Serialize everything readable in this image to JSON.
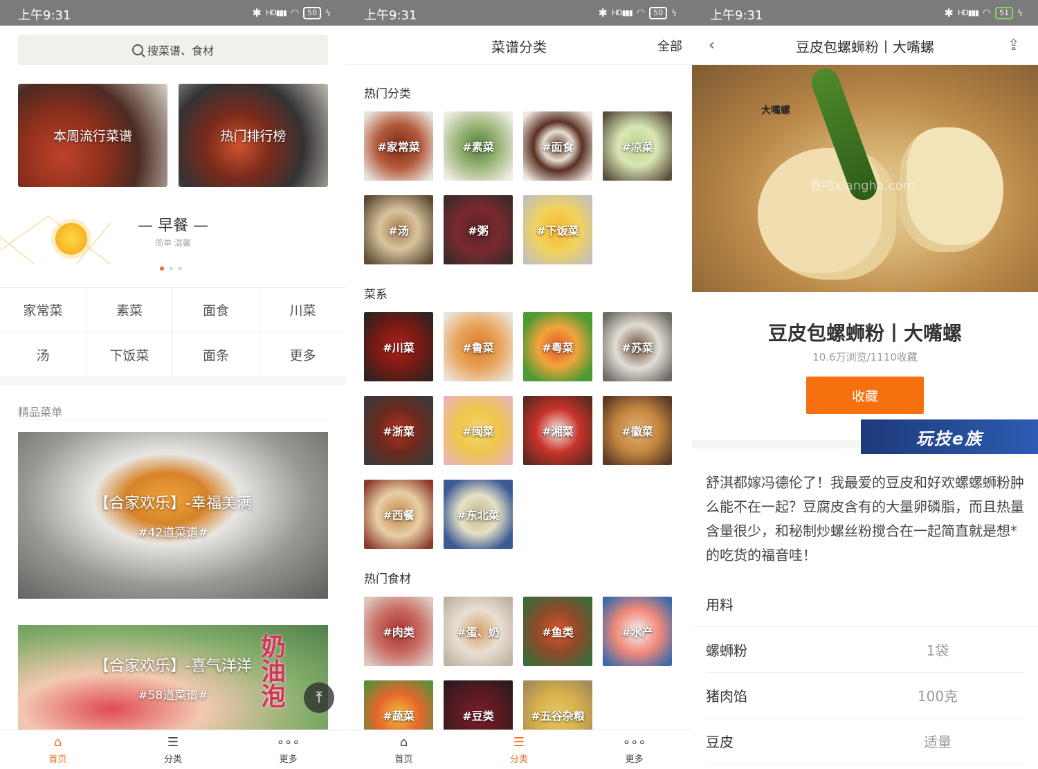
{
  "status": {
    "time": "上午9:31",
    "signal": "HD",
    "battery": [
      "50",
      "50",
      "51"
    ]
  },
  "home": {
    "search_placeholder": "搜菜谱、食材",
    "banners": [
      "本周流行菜谱",
      "热门排行榜"
    ],
    "meal": {
      "title": "— 早餐 —",
      "subtitle": "简单 温馨"
    },
    "categories": [
      "家常菜",
      "素菜",
      "面食",
      "川菜",
      "汤",
      "下饭菜",
      "面条",
      "更多"
    ],
    "section_label": "精品菜单",
    "menus": [
      {
        "title": "【合家欢乐】-幸福美满",
        "count": "#42道菜谱#"
      },
      {
        "title": "【合家欢乐】-喜气洋洋",
        "count": "#58道菜谱#"
      }
    ],
    "menu2_overlay": "奶油泡"
  },
  "tabs": [
    "首页",
    "分类",
    "更多"
  ],
  "categories_page": {
    "title": "菜谱分类",
    "right": "全部",
    "groups": [
      {
        "title": "热门分类",
        "items": [
          "#家常菜",
          "#素菜",
          "#面食",
          "#凉菜",
          "#汤",
          "#粥",
          "#下饭菜"
        ]
      },
      {
        "title": "菜系",
        "items": [
          "#川菜",
          "#鲁菜",
          "#粤菜",
          "#苏菜",
          "#浙菜",
          "#闽菜",
          "#湘菜",
          "#徽菜",
          "#西餐",
          "#东北菜"
        ]
      },
      {
        "title": "热门食材",
        "items": [
          "#肉类",
          "#蛋、奶",
          "#鱼类",
          "#水产",
          "#蔬菜",
          "#豆类",
          "#五谷杂粮"
        ]
      }
    ]
  },
  "recipe": {
    "nav_title": "豆皮包螺蛳粉丨大嘴螺",
    "title": "豆皮包螺蛳粉丨大嘴螺",
    "stats": "10.6万浏览/1110收藏",
    "favorite": "收藏",
    "image_brand": "大嘴螺",
    "watermark": "香哈xiangha.com",
    "promo": "玩技e族",
    "description": "舒淇都嫁冯德伦了！我最爱的豆皮和好欢螺螺蛳粉肿么能不在一起？豆腐皮含有的大量卵磷脂，而且热量含量很少，和秘制炒螺丝粉搅合在一起简直就是想*的吃货的福音哇！",
    "ingredients_title": "用料",
    "ingredients": [
      {
        "name": "螺蛳粉",
        "qty": "1袋"
      },
      {
        "name": "猪肉馅",
        "qty": "100克"
      },
      {
        "name": "豆皮",
        "qty": "适量"
      }
    ]
  },
  "colors": {
    "accent": "#f36d21",
    "button": "#f7700f"
  }
}
